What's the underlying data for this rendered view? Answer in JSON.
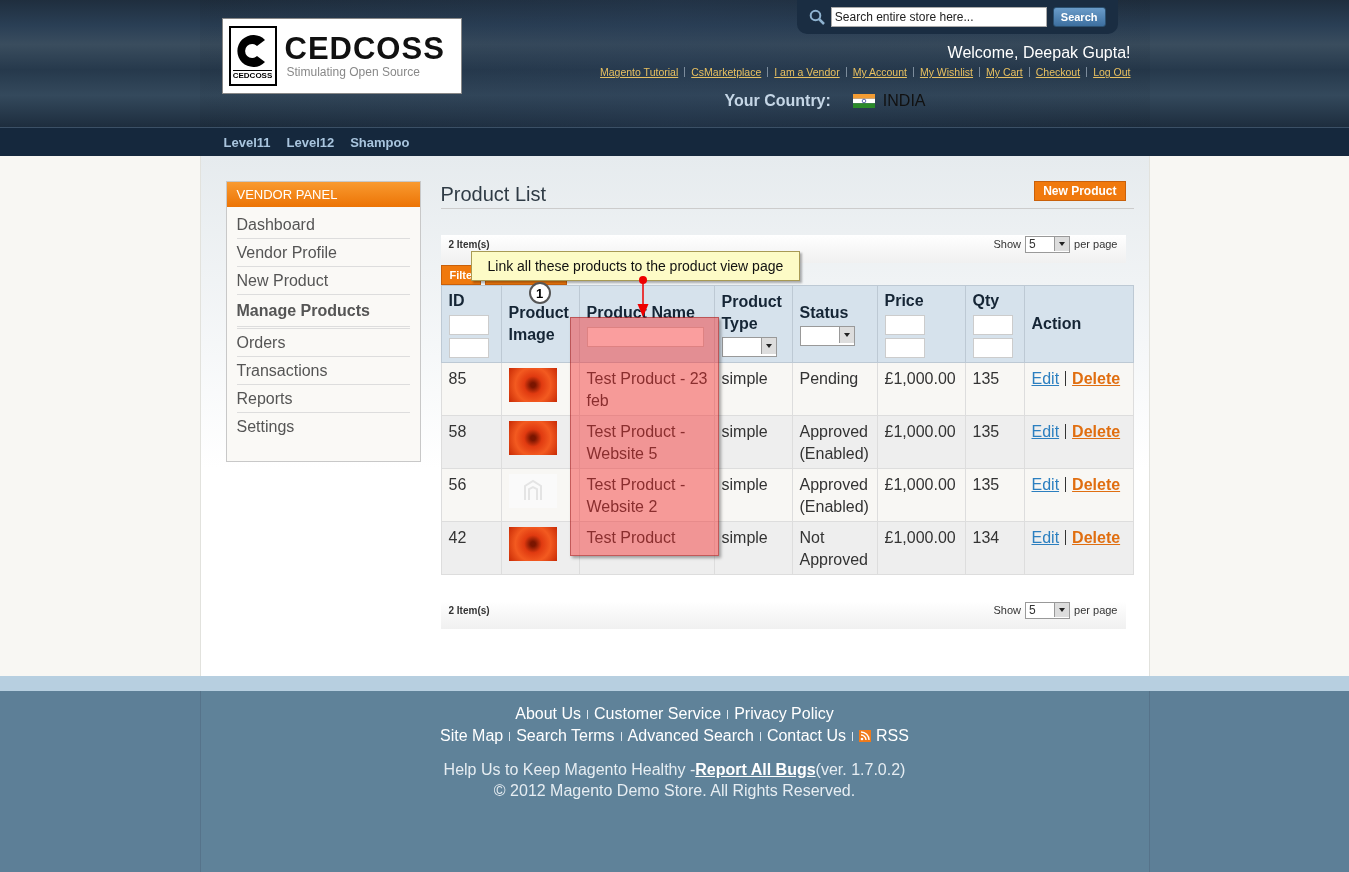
{
  "header": {
    "logo": {
      "mark_text": "CEDCOSS",
      "name": "CEDCOSS",
      "tagline": "Stimulating Open Source"
    },
    "search": {
      "placeholder": "Search entire store here...",
      "button": "Search"
    },
    "welcome": "Welcome, Deepak Gupta!",
    "links": [
      "Magento Tutorial",
      "CsMarketplace",
      "I am a Vendor",
      "My Account",
      "My Wishlist",
      "My Cart",
      "Checkout",
      "Log Out"
    ],
    "country": {
      "label": "Your Country:",
      "value": "INDIA"
    }
  },
  "nav": [
    "Level11",
    "Level12",
    "Shampoo"
  ],
  "sidebar": {
    "title": "VENDOR PANEL",
    "items": [
      {
        "label": "Dashboard",
        "selected": false
      },
      {
        "label": "Vendor Profile",
        "selected": false
      },
      {
        "label": "New Product",
        "selected": false
      },
      {
        "label": "Manage Products",
        "selected": true
      },
      {
        "label": "Orders",
        "selected": false
      },
      {
        "label": "Transactions",
        "selected": false
      },
      {
        "label": "Reports",
        "selected": false
      },
      {
        "label": "Settings",
        "selected": false
      }
    ]
  },
  "page": {
    "title": "Product List",
    "new_button": "New Product"
  },
  "pager_top": {
    "count": "2 Item(s)",
    "show": "Show",
    "per_page_value": "5",
    "per_page": "per page"
  },
  "filter_button": "Filte",
  "table": {
    "columns": [
      {
        "label": "ID",
        "kind": "range"
      },
      {
        "label": "Product Image",
        "kind": "plain"
      },
      {
        "label": "Product Name",
        "kind": "text"
      },
      {
        "label": "Product Type",
        "kind": "select"
      },
      {
        "label": "Status",
        "kind": "select"
      },
      {
        "label": "Price",
        "kind": "range"
      },
      {
        "label": "Qty",
        "kind": "range"
      },
      {
        "label": "Action",
        "kind": "plain"
      }
    ],
    "rows": [
      {
        "id": "85",
        "kind": "photo",
        "name": "Test Product - 23 feb",
        "type": "simple",
        "status": "Pending",
        "price": "£1,000.00",
        "qty": "135",
        "edit": "Edit",
        "delete": "Delete"
      },
      {
        "id": "58",
        "kind": "photo",
        "name": "Test Product - Website 5",
        "type": "simple",
        "status": "Approved (Enabled)",
        "price": "£1,000.00",
        "qty": "135",
        "edit": "Edit",
        "delete": "Delete"
      },
      {
        "id": "56",
        "kind": "placeholder",
        "name": "Test Product - Website 2",
        "type": "simple",
        "status": "Approved (Enabled)",
        "price": "£1,000.00",
        "qty": "135",
        "edit": "Edit",
        "delete": "Delete"
      },
      {
        "id": "42",
        "kind": "photo",
        "name": "Test Product",
        "type": "simple",
        "status": "Not Approved",
        "price": "£1,000.00",
        "qty": "134",
        "edit": "Edit",
        "delete": "Delete"
      }
    ]
  },
  "pager_bottom": {
    "count": "2 Item(s)",
    "show": "Show",
    "per_page_value": "5",
    "per_page": "per page"
  },
  "annotation": {
    "number": "1",
    "text": "Link all these products to the product view page"
  },
  "footer": {
    "links_row_1": [
      "About Us",
      "Customer Service",
      "Privacy Policy"
    ],
    "links_row_2": [
      "Site Map",
      "Search Terms",
      "Advanced Search",
      "Contact Us",
      "RSS"
    ],
    "help_before": "Help Us to Keep Magento Healthy -",
    "help_link": "Report All Bugs",
    "help_after": "(ver. 1.7.0.2)",
    "copyright": "© 2012 Magento Demo Store. All Rights Reserved."
  }
}
